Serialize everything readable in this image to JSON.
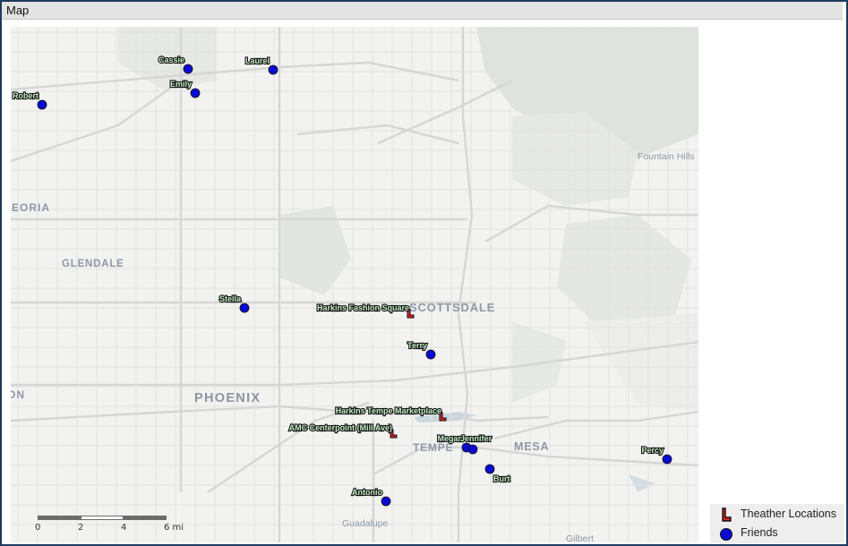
{
  "window": {
    "title": "Map"
  },
  "places": {
    "peoria": "PEORIA",
    "glendale": "GLENDALE",
    "phoenix": "PHOENIX",
    "scottsdale": "SCOTTSDALE",
    "tempe": "TEMPE",
    "mesa": "MESA",
    "fountain_hills": "Fountain Hills",
    "guadalupe": "Guadalupe",
    "gilbert": "Gilbert",
    "avondale_partial": "ON"
  },
  "friends": [
    {
      "name": "Cassie"
    },
    {
      "name": "Laurel"
    },
    {
      "name": "Emily"
    },
    {
      "name": "Robert"
    },
    {
      "name": "Stella"
    },
    {
      "name": "Terry"
    },
    {
      "name": "Megan"
    },
    {
      "name": "Jennifer"
    },
    {
      "name": "Burt"
    },
    {
      "name": "Percy"
    },
    {
      "name": "Antonio"
    }
  ],
  "theaters": [
    {
      "name": "Harkins Fashion Square"
    },
    {
      "name": "Harkins Tempe Marketplace"
    },
    {
      "name": "AMC Centerpoint (Mill Ave)"
    }
  ],
  "legend": {
    "theater_label": "Theather Locations",
    "friends_label": "Friends"
  },
  "scale_bar": {
    "labels": [
      "0",
      "2",
      "4",
      "6 mi"
    ]
  },
  "colors": {
    "friend_marker": "#0a0ad2",
    "theater_marker": "#d62020",
    "label_halo": "#ffffff",
    "label_text_fill": "#c8f0c8"
  }
}
